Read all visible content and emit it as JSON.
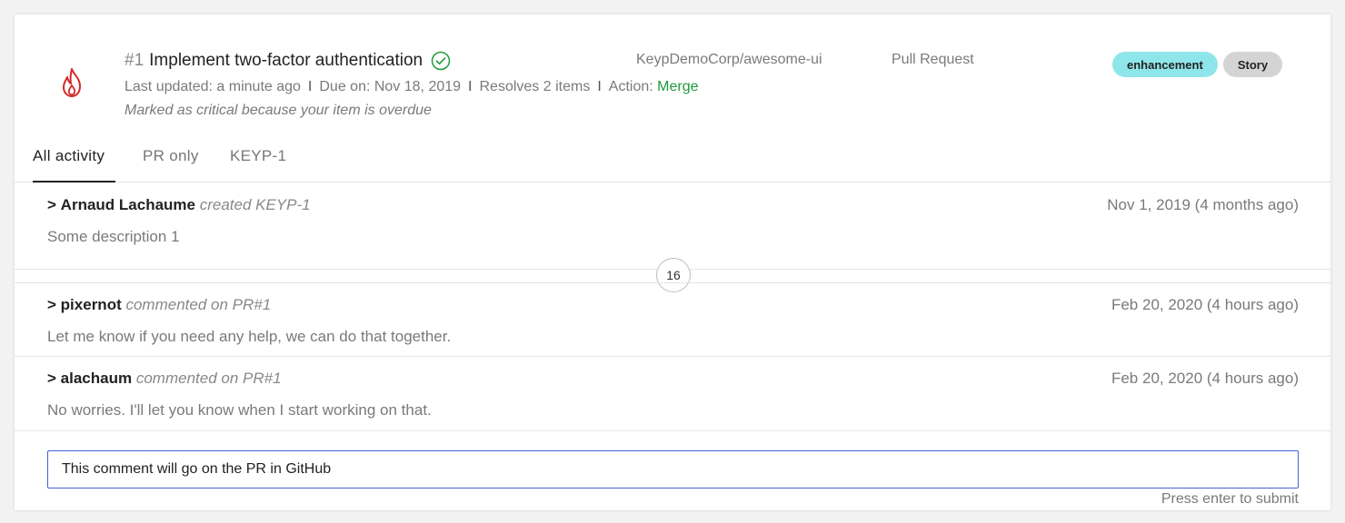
{
  "issue": {
    "number": "#1",
    "title": "Implement two-factor authentication",
    "meta": {
      "last_updated": "Last updated: a minute ago",
      "due": "Due on: Nov 18, 2019",
      "resolves": "Resolves 2 items",
      "action_label": "Action:",
      "action_value": "Merge",
      "separator": "I"
    },
    "critical_note": "Marked as critical because your item is overdue",
    "repo": "KeypDemoCorp/awesome-ui",
    "type": "Pull Request",
    "badges": [
      "enhancement",
      "Story"
    ]
  },
  "tabs": [
    "All activity",
    "PR only",
    "KEYP-1"
  ],
  "activity": [
    {
      "caret": ">",
      "author": "Arnaud Lachaume",
      "verb": "created KEYP-1",
      "date": "Nov 1, 2019 (4 months ago)",
      "body": "Some description 1"
    },
    {
      "caret": ">",
      "author": "pixernot",
      "verb": "commented on PR#1",
      "date": "Feb 20, 2020 (4 hours ago)",
      "body": "Let me know if you need any help, we can do that together."
    },
    {
      "caret": ">",
      "author": "alachaum",
      "verb": "commented on PR#1",
      "date": "Feb 20, 2020 (4 hours ago)",
      "body": "No worries. I'll let you know when I start working on that."
    }
  ],
  "collapsed_count": "16",
  "comment": {
    "value": "This comment will go on the PR in GitHub",
    "hint": "Press enter to submit"
  },
  "colors": {
    "flame": "#d42a2a",
    "check": "#1f9a3c",
    "action": "#1f9a3c",
    "badge_enhancement": "#8fe6ea",
    "badge_story": "#d4d4d4",
    "input_border": "#3f63d6"
  },
  "icons": [
    "flame-icon",
    "check-circle-icon"
  ]
}
